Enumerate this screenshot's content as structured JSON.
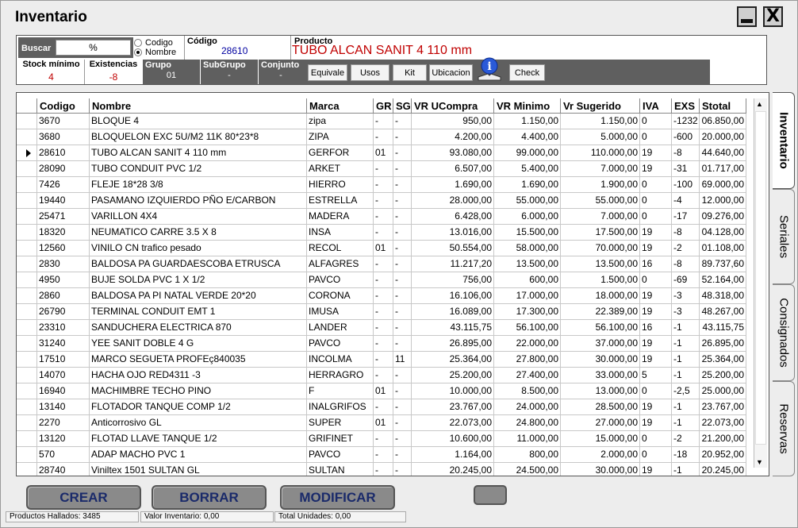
{
  "window": {
    "title": "Inventario",
    "minimize_icon": "minimize-icon",
    "close_label": "X"
  },
  "search": {
    "label": "Buscar",
    "value": "%"
  },
  "search_mode": [
    {
      "label": "Codigo",
      "selected": false
    },
    {
      "label": "Nombre",
      "selected": true
    }
  ],
  "codigo": {
    "label": "Código",
    "value": "28610"
  },
  "producto": {
    "label": "Producto",
    "value": "TUBO ALCAN SANIT 4 110 mm"
  },
  "stock_minimo": {
    "label": "Stock mínimo",
    "value": "4"
  },
  "existencias": {
    "label": "Existencias",
    "value": "-8"
  },
  "grupo": {
    "label": "Grupo",
    "value": "01"
  },
  "subgrupo": {
    "label": "SubGrupo",
    "value": "-"
  },
  "conjunto": {
    "label": "Conjunto",
    "value": "-"
  },
  "toolbar": {
    "equivale": "Equivale",
    "usos": "Usos",
    "kit": "Kit",
    "ubicacion": "Ubicacion",
    "check": "Check",
    "info_icon": "info-icon"
  },
  "columns": [
    "Codigo",
    "Nombre",
    "Marca",
    "GR",
    "SG",
    "VR UCompra",
    "VR Minimo",
    "Vr Sugerido",
    "IVA",
    "EXS",
    "Stotal"
  ],
  "rows": [
    [
      "3670",
      "BLOQUE 4",
      "zipa",
      "-",
      "-",
      "950,00",
      "1.150,00",
      "1.150,00",
      "0",
      "-1232",
      "06.850,00"
    ],
    [
      "3680",
      "BLOQUELON EXC   5U/M2 11K  80*23*8",
      "ZIPA",
      "-",
      "-",
      "4.200,00",
      "4.400,00",
      "5.000,00",
      "0",
      "-600",
      "20.000,00"
    ],
    [
      "28610",
      "TUBO ALCAN SANIT 4 110 mm",
      "GERFOR",
      "01",
      "-",
      "93.080,00",
      "99.000,00",
      "110.000,00",
      "19",
      "-8",
      "44.640,00"
    ],
    [
      "28090",
      "TUBO CONDUIT PVC  1/2",
      "ARKET",
      "-",
      "-",
      "6.507,00",
      "5.400,00",
      "7.000,00",
      "19",
      "-31",
      "01.717,00"
    ],
    [
      "7426",
      "FLEJE 18*28   3/8",
      "HIERRO",
      "-",
      "-",
      "1.690,00",
      "1.690,00",
      "1.900,00",
      "0",
      "-100",
      "69.000,00"
    ],
    [
      "19440",
      "PASAMANO IZQUIERDO PÑO   E/CARBON",
      "ESTRELLA",
      "-",
      "-",
      "28.000,00",
      "55.000,00",
      "55.000,00",
      "0",
      "-4",
      "12.000,00"
    ],
    [
      "25471",
      "VARILLON 4X4",
      "MADERA",
      "-",
      "-",
      "6.428,00",
      "6.000,00",
      "7.000,00",
      "0",
      "-17",
      "09.276,00"
    ],
    [
      "18320",
      "NEUMATICO CARRE 3.5 X 8",
      "INSA",
      "-",
      "-",
      "13.016,00",
      "15.500,00",
      "17.500,00",
      "19",
      "-8",
      "04.128,00"
    ],
    [
      "12560",
      "VINILO CN trafico pesado",
      "RECOL",
      "01",
      "-",
      "50.554,00",
      "58.000,00",
      "70.000,00",
      "19",
      "-2",
      "01.108,00"
    ],
    [
      "2830",
      "BALDOSA PA GUARDAESCOBA ETRUSCA",
      "ALFAGRES",
      "-",
      "-",
      "11.217,20",
      "13.500,00",
      "13.500,00",
      "16",
      "-8",
      "89.737,60"
    ],
    [
      "4950",
      "BUJE SOLDA PVC 1 X 1/2",
      "PAVCO",
      "-",
      "-",
      "756,00",
      "600,00",
      "1.500,00",
      "0",
      "-69",
      "52.164,00"
    ],
    [
      "2860",
      "BALDOSA PA PI NATAL VERDE 20*20",
      "CORONA",
      "-",
      "-",
      "16.106,00",
      "17.000,00",
      "18.000,00",
      "19",
      "-3",
      "48.318,00"
    ],
    [
      "26790",
      "TERMINAL CONDUIT EMT 1",
      "IMUSA",
      "-",
      "-",
      "16.089,00",
      "17.300,00",
      "22.389,00",
      "19",
      "-3",
      "48.267,00"
    ],
    [
      "23310",
      "SANDUCHERA ELECTRICA 870",
      "LANDER",
      "-",
      "-",
      "43.115,75",
      "56.100,00",
      "56.100,00",
      "16",
      "-1",
      "43.115,75"
    ],
    [
      "31240",
      "YEE SANIT   DOBLE    4    G",
      "PAVCO",
      "-",
      "-",
      "26.895,00",
      "22.000,00",
      "37.000,00",
      "19",
      "-1",
      "26.895,00"
    ],
    [
      "17510",
      "MARCO SEGUETA PROFEç840035",
      "INCOLMA",
      "-",
      "11",
      "25.364,00",
      "27.800,00",
      "30.000,00",
      "19",
      "-1",
      "25.364,00"
    ],
    [
      "14070",
      "HACHA  OJO RED4311 -3",
      "HERRAGRO",
      "-",
      "-",
      "25.200,00",
      "27.400,00",
      "33.000,00",
      "5",
      "-1",
      "25.200,00"
    ],
    [
      "16940",
      "MACHIMBRE TECHO PINO",
      "F",
      "01",
      "-",
      "10.000,00",
      "8.500,00",
      "13.000,00",
      "0",
      "-2,5",
      "25.000,00"
    ],
    [
      "13140",
      "FLOTADOR TANQUE COMP 1/2",
      "INALGRIFOS",
      "-",
      "-",
      "23.767,00",
      "24.000,00",
      "28.500,00",
      "19",
      "-1",
      "23.767,00"
    ],
    [
      "2270",
      "Anticorrosivo  GL",
      "SUPER",
      "01",
      "-",
      "22.073,00",
      "24.800,00",
      "27.000,00",
      "19",
      "-1",
      "22.073,00"
    ],
    [
      "13120",
      "FLOTAD  LLAVE TANQUE 1/2",
      "GRIFINET",
      "-",
      "-",
      "10.600,00",
      "11.000,00",
      "15.000,00",
      "0",
      "-2",
      "21.200,00"
    ],
    [
      "570",
      "ADAP MACHO PVC 1",
      "PAVCO",
      "-",
      "-",
      "1.164,00",
      "800,00",
      "2.000,00",
      "0",
      "-18",
      "20.952,00"
    ],
    [
      "28740",
      "Viniltex 1501 SULTAN  GL",
      "SULTAN",
      "-",
      "-",
      "20.245,00",
      "24.500,00",
      "30.000,00",
      "19",
      "-1",
      "20.245,00"
    ]
  ],
  "selected_row": 2,
  "tabs": [
    "Inventario",
    "Seriales",
    "Consignados",
    "Reservas"
  ],
  "actions": {
    "crear": "CREAR",
    "borrar": "BORRAR",
    "modificar": "MODIFICAR"
  },
  "status": {
    "productos": "Productos Hallados: 3485",
    "valor": "Valor Inventario: 0,00",
    "unidades": "Total Unidades: 0,00"
  }
}
